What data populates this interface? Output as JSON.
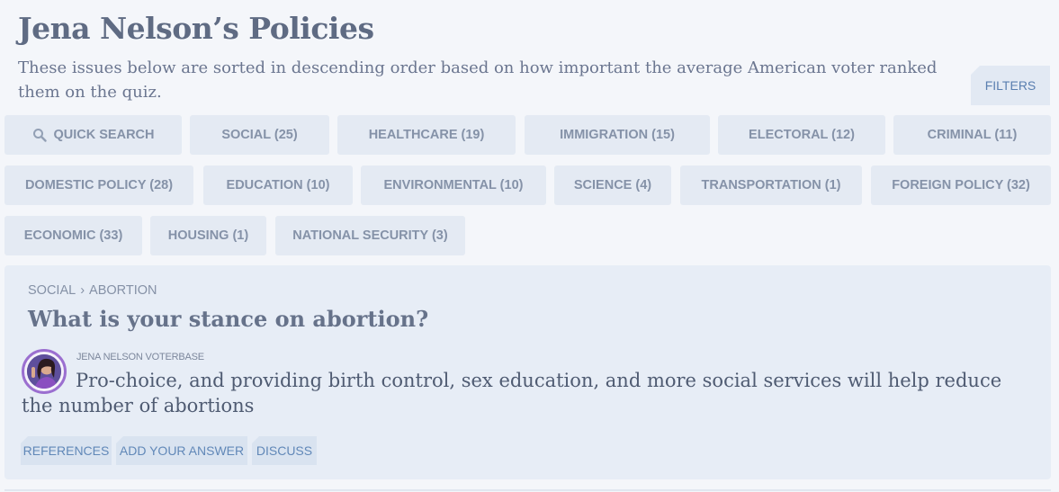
{
  "header": {
    "title": "Jena Nelson’s Policies",
    "subtitle": "These issues below are sorted in descending order based on how important the average American voter ranked them on the quiz.",
    "filters_label": "FILTERS"
  },
  "search": {
    "label": "QUICK SEARCH",
    "icon": "search-icon"
  },
  "categories": [
    {
      "label": "SOCIAL (25)"
    },
    {
      "label": "HEALTHCARE (19)"
    },
    {
      "label": "IMMIGRATION (15)"
    },
    {
      "label": "ELECTORAL (12)"
    },
    {
      "label": "CRIMINAL (11)"
    },
    {
      "label": "DOMESTIC POLICY (28)"
    },
    {
      "label": "EDUCATION (10)"
    },
    {
      "label": "ENVIRONMENTAL (10)"
    },
    {
      "label": "SCIENCE (4)"
    },
    {
      "label": "TRANSPORTATION (1)"
    },
    {
      "label": "FOREIGN POLICY (32)"
    },
    {
      "label": "ECONOMIC (33)"
    },
    {
      "label": "HOUSING (1)"
    },
    {
      "label": "NATIONAL SECURITY (3)"
    }
  ],
  "card": {
    "breadcrumb": [
      "SOCIAL",
      "›",
      "ABORTION"
    ],
    "question": "What is your stance on abortion?",
    "source": "JENA NELSON VOTERBASE",
    "answer": "Pro-choice, and providing birth control, sex education, and more social services will help reduce the number of abortions",
    "actions": [
      "REFERENCES",
      "ADD YOUR ANSWER",
      "DISCUSS"
    ]
  },
  "colors": {
    "background": "#f4f6fa",
    "chip": "#e4eaf3",
    "card": "#e7edf6",
    "accent": "#5a7fb0",
    "avatar_ring": "#9b6fd0"
  }
}
